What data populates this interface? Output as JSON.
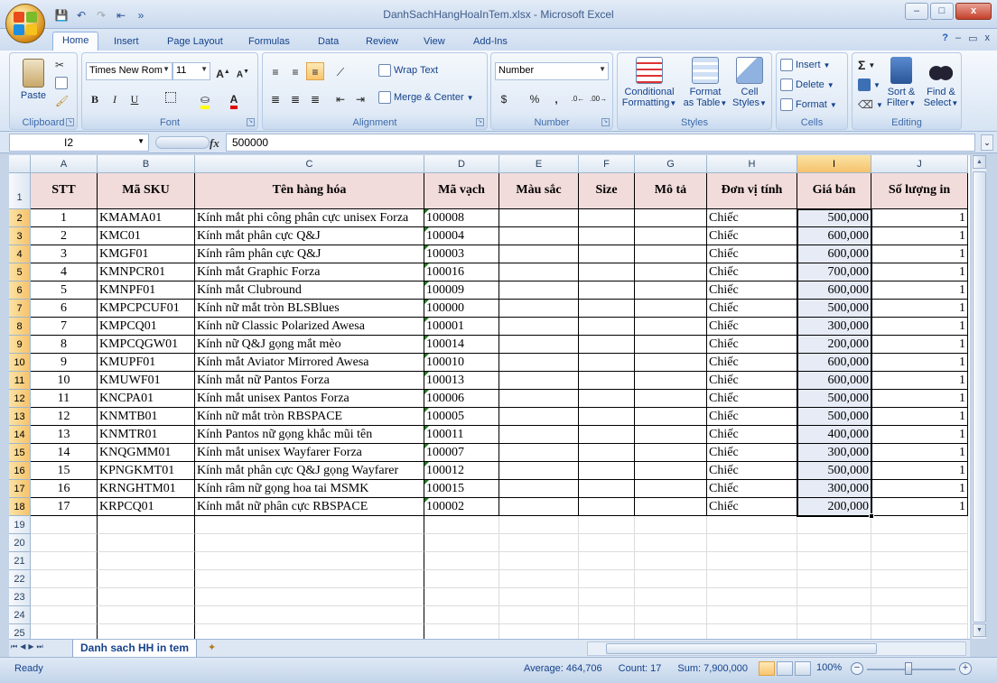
{
  "window": {
    "title": "DanhSachHangHoaInTem.xlsx - Microsoft Excel",
    "buttons": [
      "–",
      "□",
      "x"
    ]
  },
  "ribbon_tabs": [
    "Home",
    "Insert",
    "Page Layout",
    "Formulas",
    "Data",
    "Review",
    "View",
    "Add-Ins"
  ],
  "ribbon": {
    "clipboard": {
      "title": "Clipboard",
      "paste": "Paste"
    },
    "font": {
      "title": "Font",
      "font_name": "Times New Rom",
      "font_size": "11"
    },
    "alignment": {
      "title": "Alignment",
      "wrap_text": "Wrap Text",
      "merge_center": "Merge & Center"
    },
    "number": {
      "title": "Number",
      "format": "Number",
      "currency": "$",
      "percent": "%",
      "comma": ","
    },
    "styles": {
      "title": "Styles",
      "conditional": "Conditional",
      "conditional2": "Formatting",
      "format_table": "Format",
      "format_table2": "as Table",
      "cell_styles": "Cell",
      "cell_styles2": "Styles"
    },
    "cells": {
      "title": "Cells",
      "insert": "Insert",
      "delete": "Delete",
      "format": "Format"
    },
    "editing": {
      "title": "Editing",
      "sort": "Sort &",
      "sort2": "Filter",
      "find": "Find &",
      "find2": "Select",
      "sigma": "Σ"
    }
  },
  "formula_bar": {
    "name_box": "I2",
    "fx": "fx",
    "value": "500000"
  },
  "sheet": {
    "columns": [
      "A",
      "B",
      "C",
      "D",
      "E",
      "F",
      "G",
      "H",
      "I",
      "J"
    ],
    "header_row": [
      "STT",
      "Mã SKU",
      "Tên hàng hóa",
      "Mã vạch",
      "Màu sắc",
      "Size",
      "Mô tả",
      "Đơn vị tính",
      "Giá bán",
      "Số lượng in"
    ],
    "rows": [
      [
        "1",
        "KMAMA01",
        "Kính mắt phi công phân cực unisex Forza",
        "100008",
        "",
        "",
        "",
        "Chiếc",
        "500,000",
        "1"
      ],
      [
        "2",
        "KMC01",
        "Kính mắt phân cực Q&J",
        "100004",
        "",
        "",
        "",
        "Chiếc",
        "600,000",
        "1"
      ],
      [
        "3",
        "KMGF01",
        "Kính râm phân cực Q&J",
        "100003",
        "",
        "",
        "",
        "Chiếc",
        "600,000",
        "1"
      ],
      [
        "4",
        "KMNPCR01",
        "Kính mắt Graphic Forza",
        "100016",
        "",
        "",
        "",
        "Chiếc",
        "700,000",
        "1"
      ],
      [
        "5",
        "KMNPF01",
        "Kính mắt Clubround",
        "100009",
        "",
        "",
        "",
        "Chiếc",
        "600,000",
        "1"
      ],
      [
        "6",
        "KMPCPCUF01",
        "Kính nữ mắt tròn BLSBlues",
        "100000",
        "",
        "",
        "",
        "Chiếc",
        "500,000",
        "1"
      ],
      [
        "7",
        "KMPCQ01",
        "Kính nữ Classic Polarized Awesa",
        "100001",
        "",
        "",
        "",
        "Chiếc",
        "300,000",
        "1"
      ],
      [
        "8",
        "KMPCQGW01",
        "Kính nữ Q&J gọng mắt mèo",
        "100014",
        "",
        "",
        "",
        "Chiếc",
        "200,000",
        "1"
      ],
      [
        "9",
        "KMUPF01",
        "Kính mắt Aviator Mirrored Awesa",
        "100010",
        "",
        "",
        "",
        "Chiếc",
        "600,000",
        "1"
      ],
      [
        "10",
        "KMUWF01",
        "Kính mắt nữ Pantos Forza",
        "100013",
        "",
        "",
        "",
        "Chiếc",
        "600,000",
        "1"
      ],
      [
        "11",
        "KNCPA01",
        "Kính mắt unisex Pantos Forza",
        "100006",
        "",
        "",
        "",
        "Chiếc",
        "500,000",
        "1"
      ],
      [
        "12",
        "KNMTB01",
        "Kính nữ mắt tròn RBSPACE",
        "100005",
        "",
        "",
        "",
        "Chiếc",
        "500,000",
        "1"
      ],
      [
        "13",
        "KNMTR01",
        "Kính Pantos nữ gọng khắc mũi tên",
        "100011",
        "",
        "",
        "",
        "Chiếc",
        "400,000",
        "1"
      ],
      [
        "14",
        "KNQGMM01",
        "Kính mắt unisex Wayfarer Forza",
        "100007",
        "",
        "",
        "",
        "Chiếc",
        "300,000",
        "1"
      ],
      [
        "15",
        "KPNGKMT01",
        "Kính mắt phân cực Q&J gọng Wayfarer",
        "100012",
        "",
        "",
        "",
        "Chiếc",
        "500,000",
        "1"
      ],
      [
        "16",
        "KRNGHTM01",
        "Kính râm nữ gọng hoa tai MSMK",
        "100015",
        "",
        "",
        "",
        "Chiếc",
        "300,000",
        "1"
      ],
      [
        "17",
        "KRPCQ01",
        "Kính mắt nữ phân cực RBSPACE",
        "100002",
        "",
        "",
        "",
        "Chiếc",
        "200,000",
        "1"
      ]
    ],
    "row_numbers": [
      "1",
      "2",
      "3",
      "4",
      "5",
      "6",
      "7",
      "8",
      "9",
      "10",
      "11",
      "12",
      "13",
      "14",
      "15",
      "16",
      "17",
      "18",
      "19",
      "20",
      "21",
      "22",
      "23",
      "24",
      "25"
    ],
    "sheet_tab": "Danh sach HH in tem"
  },
  "status": {
    "ready": "Ready",
    "average": "Average: 464,706",
    "count": "Count: 17",
    "sum": "Sum: 7,900,000",
    "zoom": "100%"
  }
}
